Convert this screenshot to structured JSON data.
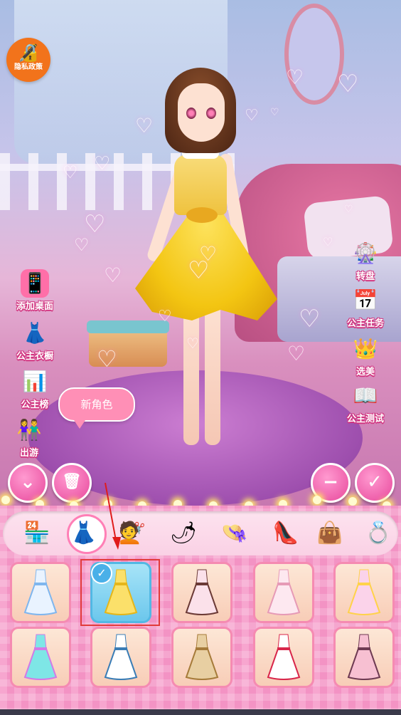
{
  "top": {
    "privacy_policy": "隐私政策",
    "privacy_icon": "document-lock-icon"
  },
  "left_menu": [
    {
      "label": "添加桌面",
      "icon": "add-desktop-icon",
      "glyph": "📱"
    },
    {
      "label": "公主衣橱",
      "icon": "wardrobe-icon",
      "glyph": "👗"
    },
    {
      "label": "公主榜",
      "icon": "ranking-icon",
      "glyph": "📊"
    },
    {
      "label": "出游",
      "icon": "outing-icon",
      "glyph": "👫"
    }
  ],
  "right_menu": [
    {
      "label": "转盘",
      "icon": "wheel-icon",
      "glyph": "🎡"
    },
    {
      "label": "公主任务",
      "icon": "task-calendar-icon",
      "glyph": "📅"
    },
    {
      "label": "选美",
      "icon": "crown-icon",
      "glyph": "👑"
    },
    {
      "label": "公主测试",
      "icon": "test-book-icon",
      "glyph": "📖"
    }
  ],
  "new_role_bubble": "新角色",
  "controls": {
    "collapse": "⌄",
    "delete": "🗑",
    "minus": "−",
    "confirm": "✓"
  },
  "categories": [
    {
      "name": "shop",
      "glyph": "🏪"
    },
    {
      "name": "dress",
      "glyph": "👗",
      "active": true
    },
    {
      "name": "hair",
      "glyph": "💇"
    },
    {
      "name": "accessory",
      "glyph": "🌶"
    },
    {
      "name": "hat",
      "glyph": "👒"
    },
    {
      "name": "shoes",
      "glyph": "👠"
    },
    {
      "name": "bag",
      "glyph": "👜"
    },
    {
      "name": "ring",
      "glyph": "💍"
    }
  ],
  "items": [
    {
      "name": "dress-blue-lace",
      "colors": [
        "#e9f3ff",
        "#7fb6ee"
      ],
      "selected": false
    },
    {
      "name": "dress-yellow",
      "colors": [
        "#fbe06a",
        "#e5b61a"
      ],
      "selected": true
    },
    {
      "name": "dress-pink-bow",
      "colors": [
        "#fbe1ea",
        "#6b3a36"
      ],
      "selected": false
    },
    {
      "name": "dress-pink-gown",
      "colors": [
        "#fde8f0",
        "#e69ab6"
      ],
      "selected": false
    },
    {
      "name": "dress-pink-ruffle",
      "colors": [
        "#fbd3ea",
        "#ffd24a"
      ],
      "selected": false
    },
    {
      "name": "dress-rainbow",
      "colors": [
        "#7ee6e6",
        "#d27ae6"
      ],
      "selected": false
    },
    {
      "name": "dress-white-blue",
      "colors": [
        "#ffffff",
        "#3a7db6"
      ],
      "selected": false
    },
    {
      "name": "dress-gold-gown",
      "colors": [
        "#e8cfa2",
        "#a67b3a"
      ],
      "selected": false
    },
    {
      "name": "dress-red-white",
      "colors": [
        "#ffffff",
        "#d8264a"
      ],
      "selected": false
    },
    {
      "name": "dress-pink-layered",
      "colors": [
        "#f7c0d2",
        "#6e3a52"
      ],
      "selected": false
    }
  ]
}
